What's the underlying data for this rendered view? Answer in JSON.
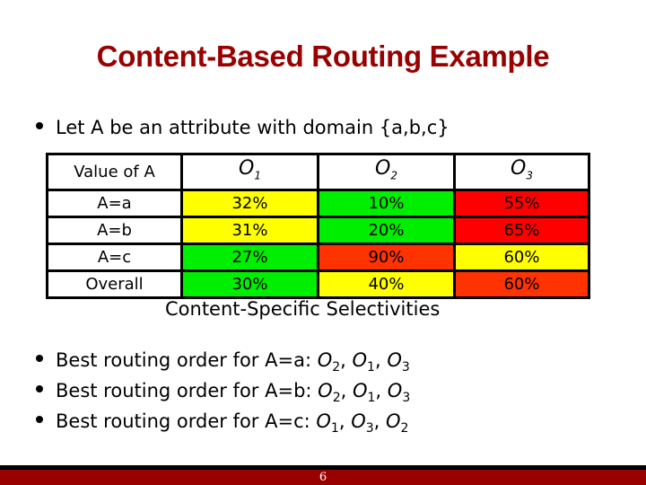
{
  "slide": {
    "title": "Content-Based Routing Example",
    "intro_bullet": "Let A be an attribute with domain {a,b,c}",
    "page_number": "6"
  },
  "colors": {
    "title": "#990000",
    "footer": "#990000",
    "low": "#00EE00",
    "mid": "#FFFF00",
    "high": "#FF0000",
    "high_alt": "#FF3300"
  },
  "table": {
    "header": {
      "label": "Value of A",
      "operators": [
        {
          "name": "O",
          "sub": "1"
        },
        {
          "name": "O",
          "sub": "2"
        },
        {
          "name": "O",
          "sub": "3"
        }
      ]
    },
    "rows": [
      {
        "label": "A=a",
        "cells": [
          {
            "value": "32%",
            "level": "mid"
          },
          {
            "value": "10%",
            "level": "low"
          },
          {
            "value": "55%",
            "level": "high"
          }
        ]
      },
      {
        "label": "A=b",
        "cells": [
          {
            "value": "31%",
            "level": "mid"
          },
          {
            "value": "20%",
            "level": "low"
          },
          {
            "value": "65%",
            "level": "high"
          }
        ]
      },
      {
        "label": "A=c",
        "cells": [
          {
            "value": "27%",
            "level": "low"
          },
          {
            "value": "90%",
            "level": "high_alt"
          },
          {
            "value": "60%",
            "level": "mid"
          }
        ]
      },
      {
        "label": "Overall",
        "cells": [
          {
            "value": "30%",
            "level": "low"
          },
          {
            "value": "40%",
            "level": "mid"
          },
          {
            "value": "60%",
            "level": "high_alt"
          }
        ]
      }
    ],
    "caption": "Content-Specific Selectivities"
  },
  "routing_orders": [
    {
      "prefix": "Best routing order for A=a: ",
      "order": [
        "2",
        "1",
        "3"
      ]
    },
    {
      "prefix": "Best routing order for A=b: ",
      "order": [
        "2",
        "1",
        "3"
      ]
    },
    {
      "prefix": "Best routing order for A=c: ",
      "order": [
        "1",
        "3",
        "2"
      ]
    }
  ],
  "operator_symbol": "O",
  "separator": ", "
}
